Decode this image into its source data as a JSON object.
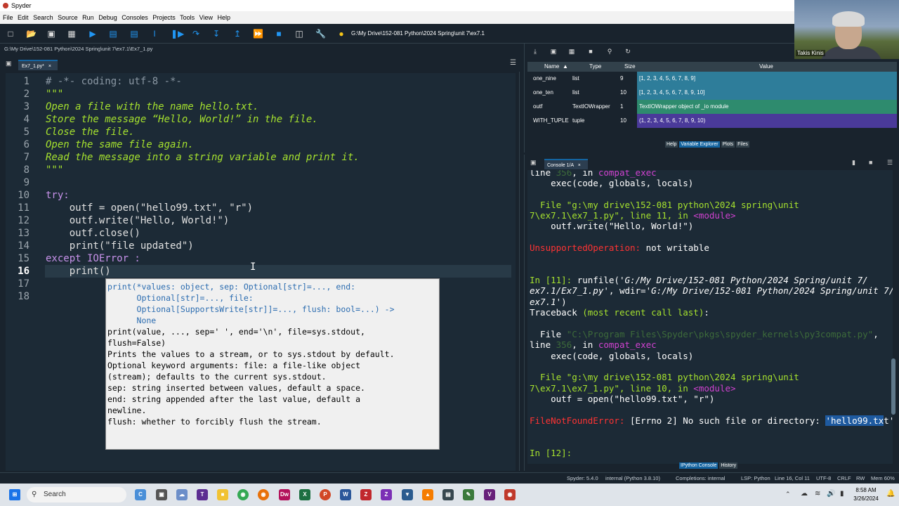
{
  "window": {
    "title": "Spyder"
  },
  "menu": [
    "File",
    "Edit",
    "Search",
    "Source",
    "Run",
    "Debug",
    "Consoles",
    "Projects",
    "Tools",
    "View",
    "Help"
  ],
  "toolbar": {
    "path": "G:\\My Drive\\152-081 Python\\2024 Spring\\unit 7\\ex7.1"
  },
  "editor": {
    "filepath": "G:\\My Drive\\152-081 Python\\2024 Spring\\unit 7\\ex7.1\\Ex7_1.py",
    "tab": "Ex7_1.py*",
    "current_line": 16,
    "lines": [
      "# -*- coding: utf-8 -*-",
      "\"\"\"",
      "Open a file with the name hello.txt.",
      "Store the message “Hello, World!” in the file.",
      "Close the file.",
      "Open the same file again.",
      "Read the message into a string variable and print it.",
      "\"\"\"",
      "",
      "try:",
      "    outf = open(\"hello99.txt\", \"r\")",
      "    outf.write(\"Hello, World!\")",
      "    outf.close()",
      "    print(\"file updated\")",
      "except IOError :",
      "    print()",
      "",
      ""
    ],
    "calltip": [
      "print(*values: object, sep: Optional[str]=..., end:",
      "      Optional[str]=..., file:",
      "      Optional[SupportsWrite[str]]=..., flush: bool=...) ->",
      "      None",
      "",
      "print(value, ..., sep=' ', end='\\n', file=sys.stdout,",
      "flush=False)",
      "",
      "Prints the values to a stream, or to sys.stdout by default.",
      "Optional keyword arguments: file: a file-like object",
      "(stream); defaults to the current sys.stdout.",
      "sep: string inserted between values, default a space.",
      "end: string appended after the last value, default a",
      "newline.",
      "flush: whether to forcibly flush the stream."
    ]
  },
  "variable_explorer": {
    "headers": [
      "Name",
      "Type",
      "Size",
      "Value"
    ],
    "rows": [
      {
        "name": "one_nine",
        "type": "list",
        "size": "9",
        "value": "[1, 2, 3, 4, 5, 6, 7, 8, 9]",
        "color": "#2e7d9a"
      },
      {
        "name": "one_ten",
        "type": "list",
        "size": "10",
        "value": "[1, 2, 3, 4, 5, 6, 7, 8, 9, 10]",
        "color": "#2e7d9a"
      },
      {
        "name": "outf",
        "type": "TextIOWrapper",
        "size": "1",
        "value": "TextIOWrapper object of _io module",
        "color": "#2e8b6e"
      },
      {
        "name": "WITH_TUPLE",
        "type": "tuple",
        "size": "10",
        "value": "(1, 2, 3, 4, 5, 6, 7, 8, 9, 10)",
        "color": "#4a3a9a"
      }
    ],
    "tabs": [
      "Help",
      "Variable Explorer",
      "Plots",
      "Files"
    ]
  },
  "console": {
    "tab": "Console 1/A",
    "tabs": [
      "IPython Console",
      "History"
    ],
    "lines": {
      "l1a": "line ",
      "l1b": "356",
      "l1c": ", in ",
      "l1d": "compat_exec",
      "l2": "    exec(code, globals, locals)",
      "l3": "  File \"g:\\my drive\\152-081 python\\2024 spring\\unit",
      "l4a": "7\\ex7.1\\ex7_1.py\", line 11, in ",
      "l4b": "<module>",
      "l5": "    outf.write(\"Hello, World!\")",
      "l6a": "UnsupportedOperation:",
      "l6b": " not writable",
      "l7a": "In [11]: ",
      "l7b": "runfile(",
      "l7c": "'G:/My Drive/152-081 Python/2024 Spring/unit 7/",
      "l8a": "ex7.1/Ex7_1.py'",
      "l8b": ", wdir=",
      "l8c": "'G:/My Drive/152-081 Python/2024 Spring/unit 7/",
      "l9a": "ex7.1'",
      "l9b": ")",
      "l10a": "Traceback ",
      "l10b": "(most recent call last)",
      "l10c": ":",
      "l11a": "  File ",
      "l11b": "\"C:\\Program Files\\Spyder\\pkgs\\spyder_kernels\\py3compat.py\"",
      "l11c": ",",
      "l12a": "line ",
      "l12b": "356",
      "l12c": ", in ",
      "l12d": "compat_exec",
      "l13": "    exec(code, globals, locals)",
      "l14": "  File \"g:\\my drive\\152-081 python\\2024 spring\\unit",
      "l15a": "7\\ex7.1\\ex7_1.py\", line 10, in ",
      "l15b": "<module>",
      "l16": "    outf = open(\"hello99.txt\", \"r\")",
      "l17a": "FileNotFoundError:",
      "l17b": " [Errno 2] No such file or directory: ",
      "l17c": "'hello99.tx",
      "l17d": "t'",
      "l18": "In [12]:"
    }
  },
  "status": {
    "version": "Spyder: 5.4.0",
    "interpreter": "internal (Python 3.8.10)",
    "completions": "Completions: internal",
    "lsp": "LSP: Python",
    "position": "Line 16, Col 11",
    "encoding": "UTF-8",
    "eol": "CRLF",
    "rw": "RW",
    "mem": "Mem 60%"
  },
  "taskbar": {
    "search": "Search",
    "time": "8:58 AM",
    "date": "3/26/2024"
  },
  "webcam": {
    "name": "Takis Kinis"
  }
}
